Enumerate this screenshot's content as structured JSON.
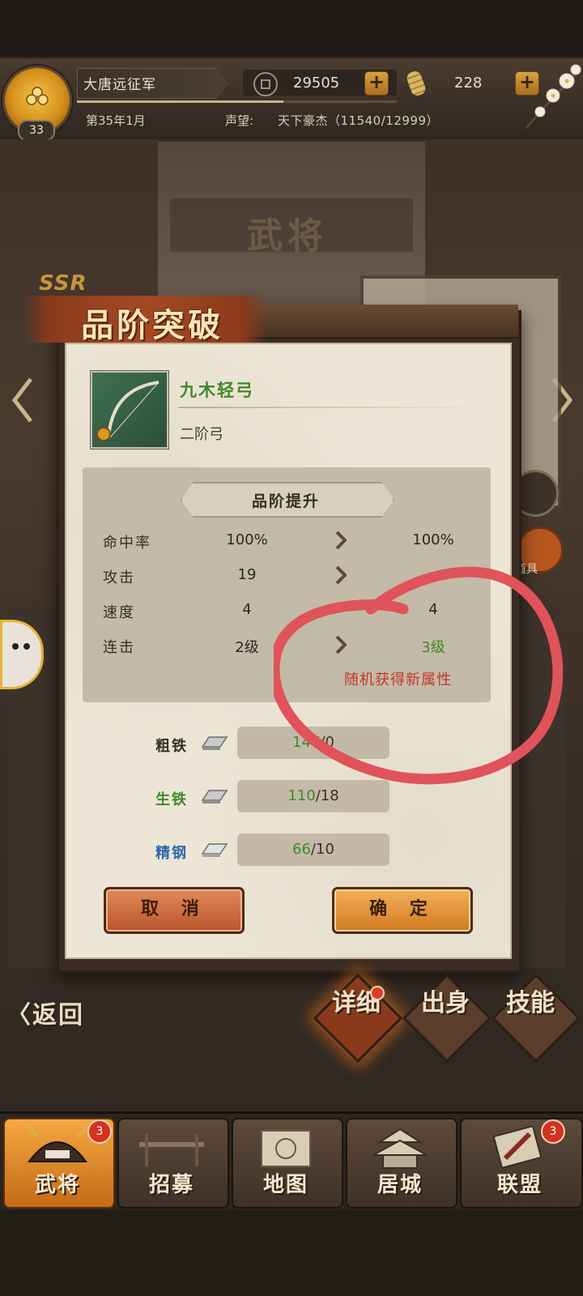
{
  "header": {
    "army_name": "大唐远征军",
    "level": "33",
    "gold": "29505",
    "tickets": "228",
    "date": "第35年1月",
    "fame_label": "声望:",
    "fame_value": "天下豪杰（11540/12999）"
  },
  "background": {
    "title": "武将",
    "rarity": "SSR",
    "right_badge_label": "用道具"
  },
  "modal": {
    "title": "品阶突破",
    "item": {
      "name": "九木轻弓",
      "subtitle": "二阶弓"
    },
    "stats_header": "品阶提升",
    "stats": [
      {
        "label": "命中率",
        "before": "100%",
        "after": "100%",
        "after_highlight": false
      },
      {
        "label": "攻击",
        "before": "19",
        "after": "",
        "after_highlight": false
      },
      {
        "label": "速度",
        "before": "4",
        "after": "4",
        "after_highlight": false
      },
      {
        "label": "连击",
        "before": "2级",
        "after": "3级",
        "after_highlight": true
      }
    ],
    "random_note": "随机获得新属性",
    "materials": [
      {
        "label": "粗铁",
        "have": "147",
        "sep": "/",
        "need": "0",
        "color": "#3a2e24"
      },
      {
        "label": "生铁",
        "have": "110",
        "sep": "/",
        "need": "18",
        "color": "#3f8a2c"
      },
      {
        "label": "精钢",
        "have": "66",
        "sep": "/",
        "need": "10",
        "color": "#2b6aa8"
      }
    ],
    "cancel_label": "取 消",
    "confirm_label": "确 定"
  },
  "actions": {
    "back_label": "〈返回",
    "detail_label": "详细",
    "origin_label": "出身",
    "skill_label": "技能"
  },
  "nav": {
    "tabs": [
      {
        "label": "武将",
        "badge": "3",
        "active": true
      },
      {
        "label": "招募",
        "badge": "",
        "active": false
      },
      {
        "label": "地图",
        "badge": "",
        "active": false
      },
      {
        "label": "居城",
        "badge": "",
        "active": false
      },
      {
        "label": "联盟",
        "badge": "3",
        "active": false
      }
    ]
  },
  "colors": {
    "accent_orange": "#f4a742",
    "annotation_red": "#e0535a",
    "green_text": "#3f8a2c",
    "blue_text": "#2b6aa8"
  }
}
